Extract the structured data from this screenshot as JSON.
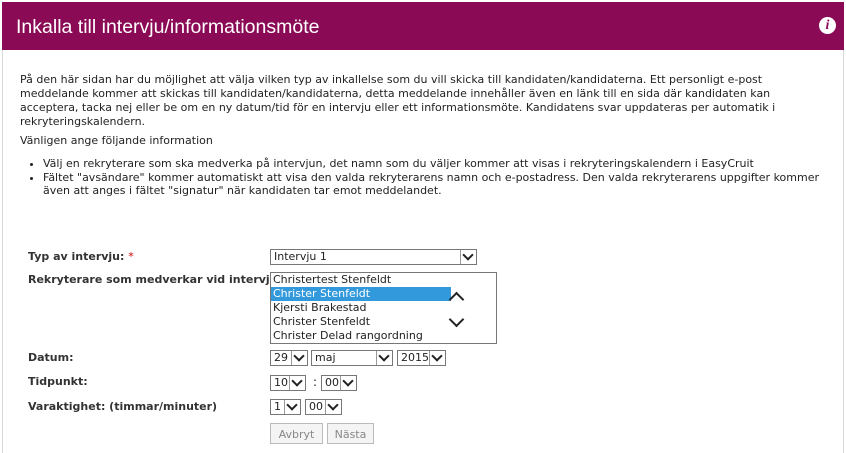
{
  "header": {
    "title": "Inkalla till intervju/informationsmöte",
    "info_icon": "i"
  },
  "intro": "På den här sidan har du möjlighet att välja vilken typ av inkallelse som du vill skicka till kandidaten/kandidaterna. Ett personligt e-post meddelande kommer att skickas till kandidaten/kandidaterna, detta meddelande innehåller även en länk till en sida där kandidaten kan acceptera, tacka nej eller be om en ny datum/tid för en intervju eller ett informationsmöte. Kandidatens svar uppdateras per automatik i rekryteringskalendern.",
  "subheading": "Vänligen ange följande information",
  "bullets": [
    "Välj en rekryterare som ska medverka på intervjun, det namn som du väljer kommer att visas i rekryteringskalendern i EasyCruit",
    "Fältet \"avsändare\" kommer automatiskt att visa den valda rekryterarens namn och e-postadress. Den valda rekryterarens uppgifter kommer även att anges i fältet \"signatur\" när kandidaten tar emot meddelandet."
  ],
  "form": {
    "interview_type": {
      "label": "Typ av intervju:",
      "required_mark": "*",
      "value": "Intervju 1"
    },
    "recruiters": {
      "label": "Rekryterare som medverkar vid intervju:",
      "options": [
        "Christertest Stenfeldt",
        "Christer Stenfeldt",
        "Kjersti Brakestad",
        "Christer Stenfeldt",
        "Christer Delad rangordning"
      ],
      "selected_index": 1
    },
    "date": {
      "label": "Datum:",
      "day": "29",
      "month": "maj",
      "year": "2015"
    },
    "time": {
      "label": "Tidpunkt:",
      "hour": "10",
      "separator": ":",
      "minute": "00"
    },
    "duration": {
      "label": "Varaktighet: (timmar/minuter)",
      "hours": "1",
      "minutes": "00"
    }
  },
  "buttons": {
    "cancel": "Avbryt",
    "next": "Nästa"
  },
  "colors": {
    "header_bg": "#8b0a55",
    "selected_option": "#3399dd",
    "required": "#cc0000"
  }
}
